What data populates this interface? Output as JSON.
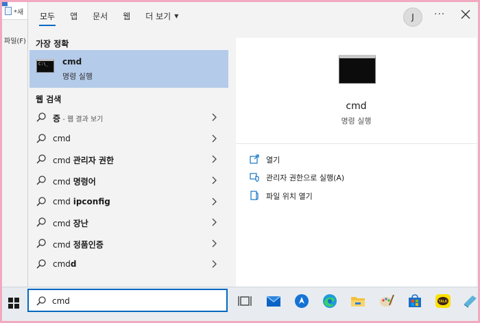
{
  "background_app": {
    "tab_text": "*새",
    "menu_text": "파일(F)"
  },
  "topbar": {
    "tabs": [
      {
        "label": "모두",
        "active": true
      },
      {
        "label": "앱"
      },
      {
        "label": "문서"
      },
      {
        "label": "웹"
      },
      {
        "label": "더 보기"
      }
    ],
    "avatar_initial": "J",
    "more_label": "···"
  },
  "best_match": {
    "section_title": "가장 정확",
    "title": "cmd",
    "subtitle": "명령 실행"
  },
  "web_search": {
    "section_title": "웹 검색",
    "results": [
      {
        "normal": "",
        "bold": "증",
        "suffix": " - 웹 결과 보기"
      },
      {
        "normal": "cmd",
        "bold": "",
        "suffix": ""
      },
      {
        "normal": "cmd ",
        "bold": "관리자 권한",
        "suffix": ""
      },
      {
        "normal": "cmd ",
        "bold": "명령어",
        "suffix": ""
      },
      {
        "normal": "cmd ",
        "bold": "ipconfig",
        "suffix": ""
      },
      {
        "normal": "cmd ",
        "bold": "장난",
        "suffix": ""
      },
      {
        "normal": "cmd ",
        "bold": "정품인증",
        "suffix": ""
      },
      {
        "normal": "cmd",
        "bold": "d",
        "suffix": ""
      }
    ]
  },
  "preview": {
    "title": "cmd",
    "subtitle": "명령 실행",
    "actions": [
      {
        "label": "열기",
        "icon": "open-icon"
      },
      {
        "label": "관리자 권한으로 실행(A)",
        "icon": "shield-icon"
      },
      {
        "label": "파일 위치 열기",
        "icon": "folder-location-icon"
      }
    ]
  },
  "taskbar": {
    "search_value": "cmd",
    "icons": [
      "task-view-icon",
      "mail-icon",
      "app-icon",
      "edge-icon",
      "file-explorer-icon",
      "paint-icon",
      "store-icon",
      "kakaotalk-icon",
      "app-icon-2"
    ],
    "kakao_label": "TALK"
  },
  "colors": {
    "accent": "#0067c0",
    "best_match_highlight": "#b4cbea",
    "frame_border": "#f1a9bf"
  }
}
